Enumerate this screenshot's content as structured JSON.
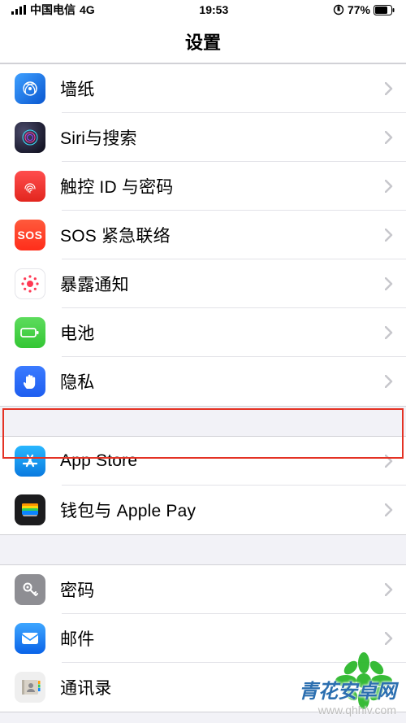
{
  "status": {
    "carrier": "中国电信",
    "network": "4G",
    "time": "19:53",
    "battery": "77%"
  },
  "title": "设置",
  "groups": [
    {
      "items": [
        {
          "label": "墙纸",
          "icon": "wallpaper"
        },
        {
          "label": "Siri与搜索",
          "icon": "siri"
        },
        {
          "label": "触控 ID 与密码",
          "icon": "touchid"
        },
        {
          "label": "SOS 紧急联络",
          "icon": "sos"
        },
        {
          "label": "暴露通知",
          "icon": "exposure"
        },
        {
          "label": "电池",
          "icon": "battery"
        },
        {
          "label": "隐私",
          "icon": "privacy",
          "highlighted": true
        }
      ]
    },
    {
      "items": [
        {
          "label": "App Store",
          "icon": "appstore"
        },
        {
          "label": "钱包与 Apple Pay",
          "icon": "wallet"
        }
      ]
    },
    {
      "items": [
        {
          "label": "密码",
          "icon": "passwords"
        },
        {
          "label": "邮件",
          "icon": "mail"
        },
        {
          "label": "通讯录",
          "icon": "contacts"
        }
      ]
    }
  ],
  "watermark": {
    "name": "青花安卓网",
    "url": "www.qhhlv.com"
  },
  "icons": {
    "sos_text": "SOS"
  }
}
